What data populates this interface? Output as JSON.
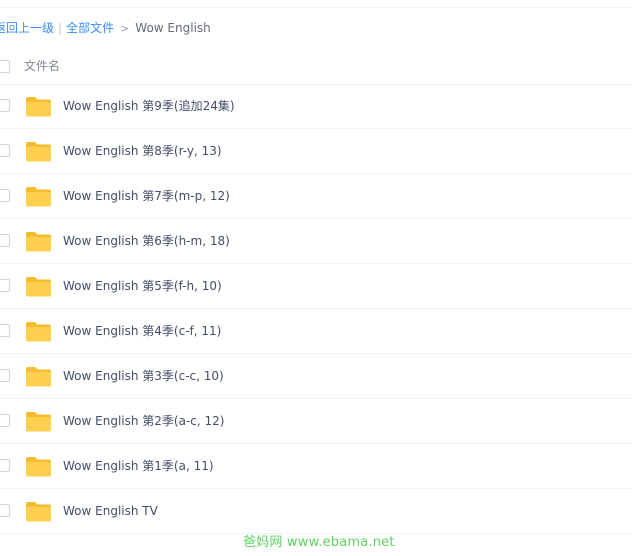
{
  "breadcrumb": {
    "back_label": "返回上一级",
    "separator": "|",
    "all_files_label": "全部文件",
    "arrow": ">",
    "current": "Wow English"
  },
  "header": {
    "name_column": "文件名"
  },
  "files": [
    {
      "name": "Wow English 第9季(追加24集)",
      "icon": "folder-icon"
    },
    {
      "name": "Wow English 第8季(r-y, 13)",
      "icon": "folder-icon"
    },
    {
      "name": "Wow English 第7季(m-p, 12)",
      "icon": "folder-icon"
    },
    {
      "name": "Wow English 第6季(h-m, 18)",
      "icon": "folder-icon"
    },
    {
      "name": "Wow English 第5季(f-h, 10)",
      "icon": "folder-icon"
    },
    {
      "name": "Wow English 第4季(c-f, 11)",
      "icon": "folder-icon"
    },
    {
      "name": "Wow English 第3季(c-c, 10)",
      "icon": "folder-icon"
    },
    {
      "name": "Wow English 第2季(a-c, 12)",
      "icon": "folder-icon"
    },
    {
      "name": "Wow English 第1季(a, 11)",
      "icon": "folder-icon"
    },
    {
      "name": "Wow English TV",
      "icon": "folder-icon"
    }
  ],
  "watermark": "爸妈网 www.ebama.net",
  "colors": {
    "link": "#3b8cff",
    "folder": "#ffd04d",
    "folder_tab": "#f5bd2e",
    "watermark": "#5dd35d",
    "text": "#424e67"
  }
}
